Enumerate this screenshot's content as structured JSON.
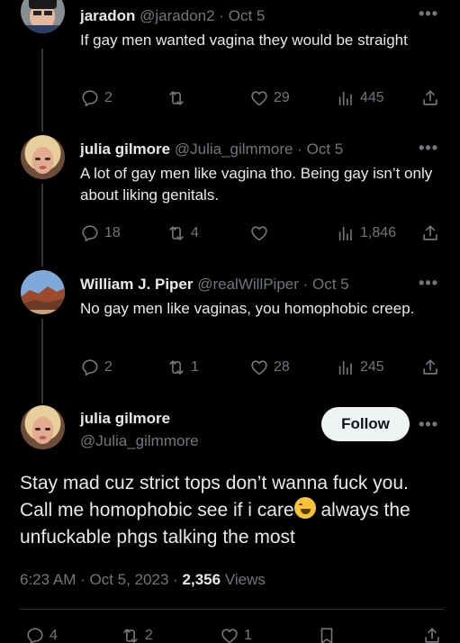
{
  "tweets": [
    {
      "name": "jaradon",
      "handle": "@jaradon2",
      "date": "Oct 5",
      "text": "If gay men wanted vagina they would be straight",
      "replies": "2",
      "retweets": "",
      "likes": "29",
      "views": "445"
    },
    {
      "name": "julia gilmore",
      "handle": "@Julia_gilmmore",
      "date": "Oct 5",
      "text": "A lot of gay men like vagina tho. Being gay isn’t only about liking genitals.",
      "replies": "18",
      "retweets": "4",
      "likes": "",
      "views": "1,846"
    },
    {
      "name": "William J. Piper",
      "handle": "@realWillPiper",
      "date": "Oct 5",
      "text": "No gay men like vaginas, you homophobic creep.",
      "replies": "2",
      "retweets": "1",
      "likes": "28",
      "views": "245"
    }
  ],
  "main": {
    "name": "julia gilmore",
    "handle": "@Julia_gilmmore",
    "follow_label": "Follow",
    "text_before_emoji": "Stay mad cuz strict tops don’t wanna fuck you. Call me homophobic see if i care",
    "emoji": "rolling-on-floor-laughing",
    "text_after_emoji": " always the unfuckable phgs talking the most",
    "time": "6:23 AM",
    "date": "Oct 5, 2023",
    "views_count": "2,356",
    "views_label": "Views",
    "replies": "4",
    "retweets": "2",
    "likes": "1"
  },
  "separator": "·",
  "more_glyph": "•••"
}
